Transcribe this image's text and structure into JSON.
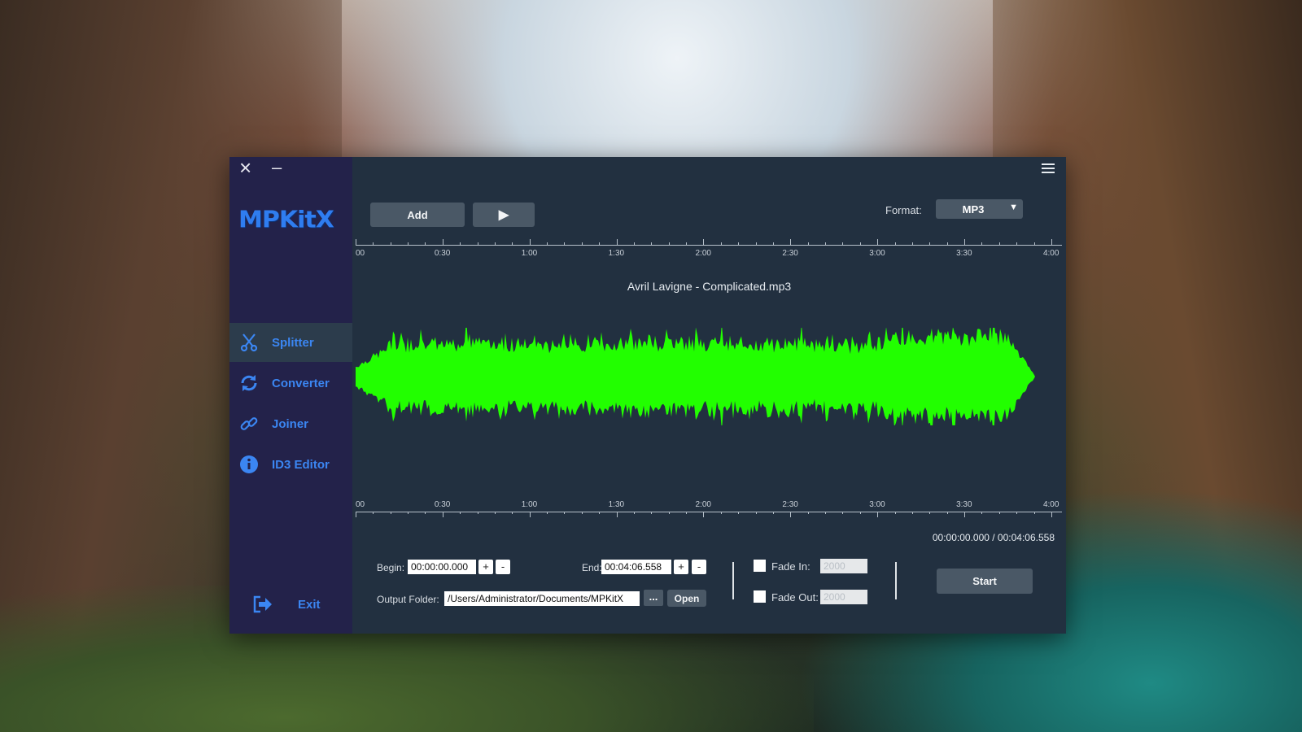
{
  "app": {
    "logo_text": "MPKitX"
  },
  "window": {
    "close_icon": "×",
    "minimize_icon": "–"
  },
  "sidebar": {
    "items": [
      {
        "label": "Splitter",
        "icon": "scissors-icon",
        "active": true
      },
      {
        "label": "Converter",
        "icon": "convert-icon",
        "active": false
      },
      {
        "label": "Joiner",
        "icon": "link-icon",
        "active": false
      },
      {
        "label": "ID3 Editor",
        "icon": "info-icon",
        "active": false
      }
    ],
    "exit_label": "Exit"
  },
  "toolbar": {
    "add_label": "Add",
    "play_icon": "▶",
    "format_label": "Format:",
    "format_value": "MP3",
    "dropdown_icon": "▼"
  },
  "timeline": {
    "tick_labels": [
      "00",
      "0:30",
      "1:00",
      "1:30",
      "2:00",
      "2:30",
      "3:00",
      "3:30",
      "4:00"
    ]
  },
  "waveform": {
    "file_name": "Avril Lavigne - Complicated.mp3",
    "color": "#22ff00"
  },
  "time_readout": "00:00:00.000 / 00:04:06.558",
  "controls": {
    "begin_label": "Begin:",
    "begin_value": "00:00:00.000",
    "end_label": "End:",
    "end_value": "00:04:06.558",
    "plus": "+",
    "minus": "-",
    "output_label": "Output Folder:",
    "output_value": "/Users/Administrator/Documents/MPKitX",
    "browse_label": "...",
    "open_label": "Open",
    "fade_in_label": "Fade In:",
    "fade_in_value": "2000",
    "fade_out_label": "Fade Out:",
    "fade_out_value": "2000",
    "start_label": "Start"
  },
  "colors": {
    "accent": "#3b86f2",
    "sidebar": "#23224a",
    "panel": "#223040"
  }
}
